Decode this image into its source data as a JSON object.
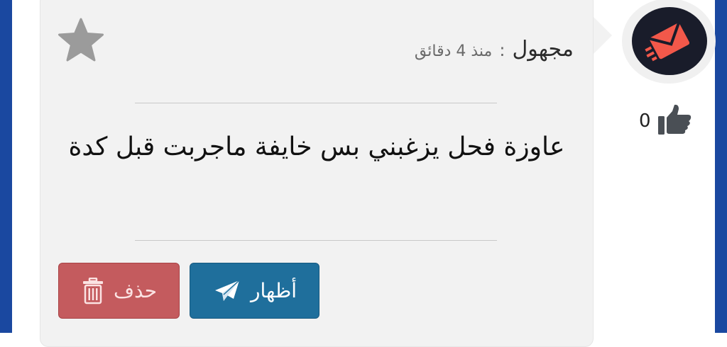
{
  "post": {
    "author": "مجهول",
    "separator": ":",
    "time": "منذ 4 دقائق",
    "message": "عاوزة فحل يزغبني بس خايفة ماجربت قبل كدة"
  },
  "actions": {
    "show_label": "أظهار",
    "delete_label": "حذف"
  },
  "likes": {
    "count": "0"
  },
  "icons": {
    "favorite": "star-icon",
    "like": "thumbs-up-icon",
    "show": "paper-plane-icon",
    "delete": "trash-icon",
    "avatar": "envelope-logo"
  },
  "colors": {
    "frame": "#1a48a0",
    "card": "#f2f2f2",
    "show_button": "#1f6f9c",
    "delete_button": "#c45b5e",
    "avatar_bg": "#191c2a",
    "avatar_accent": "#f2584a",
    "star": "#9b9b9b",
    "thumb": "#4a4f55"
  }
}
